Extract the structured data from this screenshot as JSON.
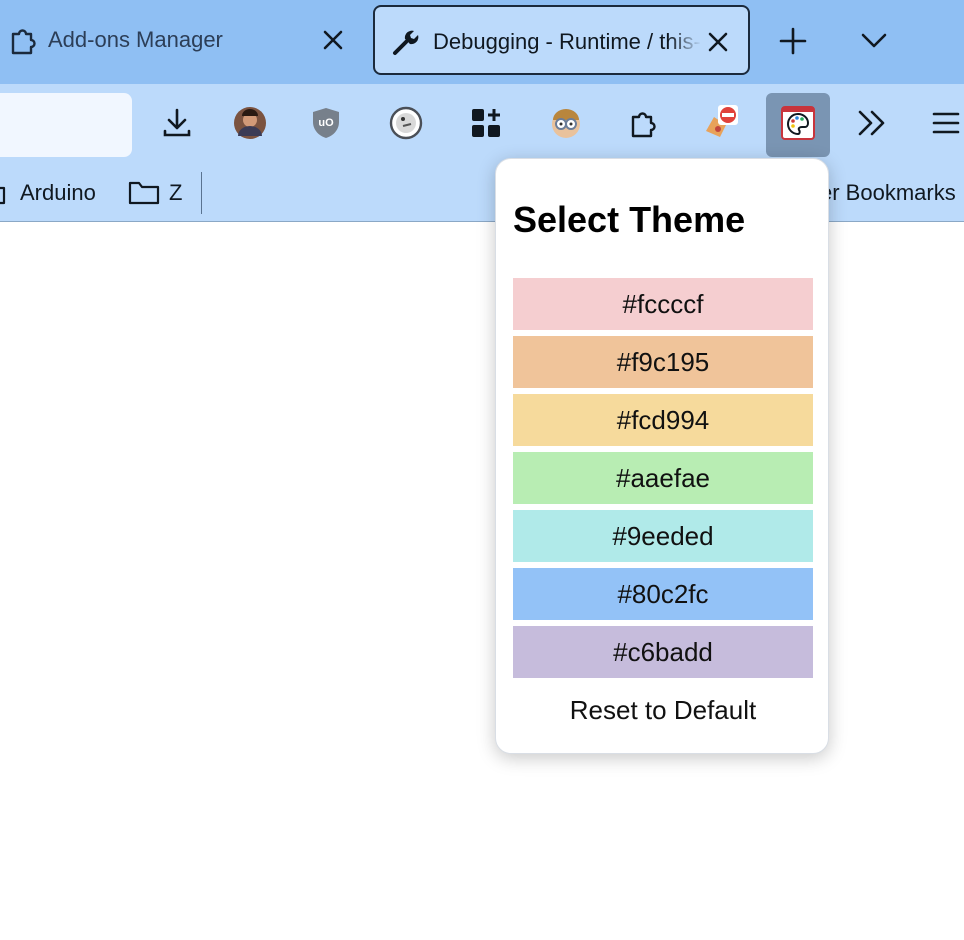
{
  "tabs": [
    {
      "title": "Add-ons Manager",
      "icon": "puzzle-icon",
      "active": false
    },
    {
      "title": "Debugging - Runtime / this-firefox",
      "icon": "wrench-icon",
      "active": true
    }
  ],
  "tabstrip": {
    "new_tab_icon": "plus-icon",
    "list_tabs_icon": "chevron-down-icon"
  },
  "toolbar": {
    "buttons": [
      {
        "name": "download-icon"
      },
      {
        "name": "avatar-extension-icon"
      },
      {
        "name": "ublock-shield-icon"
      },
      {
        "name": "duckduckgo-icon"
      },
      {
        "name": "apps-grid-plus-icon"
      },
      {
        "name": "glasses-face-icon"
      },
      {
        "name": "puzzle-icon"
      },
      {
        "name": "blocked-extension-icon"
      },
      {
        "name": "palette-icon"
      },
      {
        "name": "overflow-chevrons-icon"
      },
      {
        "name": "hamburger-menu-icon"
      }
    ]
  },
  "bookmarks": {
    "items": [
      {
        "label": "Arduino",
        "icon": "folder-icon"
      },
      {
        "label": "Z",
        "icon": "folder-icon"
      }
    ],
    "other_label": "er Bookmarks"
  },
  "popup": {
    "title": "Select Theme",
    "swatches": [
      {
        "label": "#fccccf",
        "color": "#f5ced0"
      },
      {
        "label": "#f9c195",
        "color": "#f0c49a"
      },
      {
        "label": "#fcd994",
        "color": "#f6da9c"
      },
      {
        "label": "#aaefae",
        "color": "#b8edb3"
      },
      {
        "label": "#9eeded",
        "color": "#b0eae9"
      },
      {
        "label": "#80c2fc",
        "color": "#93c2f7"
      },
      {
        "label": "#c6badd",
        "color": "#c6bcdc"
      }
    ],
    "reset_label": "Reset to Default"
  },
  "colors": {
    "tabstrip": "#8fbff3",
    "toolbar": "#bcdafb",
    "active_button": "#7a95b3"
  }
}
